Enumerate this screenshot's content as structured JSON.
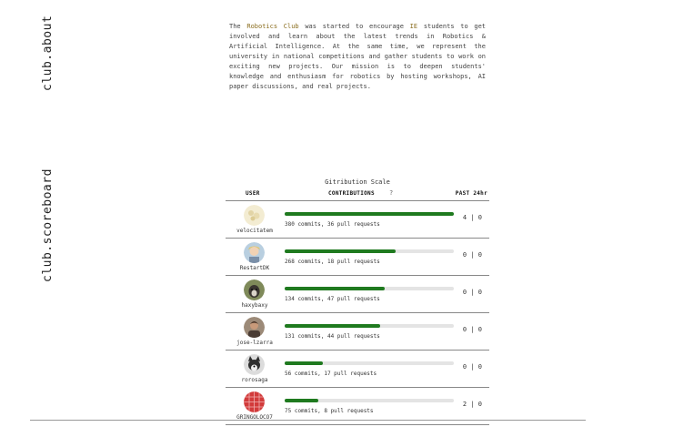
{
  "side_labels": {
    "about": "club.about",
    "scoreboard": "club.scoreboard"
  },
  "about": {
    "text_before": "The ",
    "club_name": "Robotics Club",
    "text_middle": " was started to encourage ",
    "ie": "IE",
    "text_after": " students to get involved and learn about the latest trends in Robotics & Artificial Intelligence. At the same time, we represent the university in national competitions and gather students to work on exciting new projects. Our mission is to deepen students' knowledge and enthusiasm for robotics by hosting workshops, AI paper discussions, and real projects."
  },
  "scoreboard": {
    "title": "Gitribution Scale",
    "headers": {
      "user": "USER",
      "contributions": "CONTRIBUTIONS",
      "help": "?",
      "past": "PAST 24hr"
    },
    "rows": [
      {
        "user": "velocitatem",
        "stats": "380 commits, 36 pull requests",
        "past": "4 | 0",
        "progress": 1.0,
        "avatar": "light-pattern-avatar"
      },
      {
        "user": "RestartDK",
        "stats": "268 commits, 18 pull requests",
        "past": "0 | 0",
        "progress": 0.655,
        "avatar": "cartoon-blonde-avatar"
      },
      {
        "user": "haxybaxy",
        "stats": "134 commits, 47 pull requests",
        "past": "0 | 0",
        "progress": 0.59,
        "avatar": "dog-photo-avatar"
      },
      {
        "user": "jose-lzarra",
        "stats": "131 commits, 44 pull requests",
        "past": "0 | 0",
        "progress": 0.565,
        "avatar": "person-photo-avatar"
      },
      {
        "user": "rorosaga",
        "stats": "56 commits, 17 pull requests",
        "past": "0 | 0",
        "progress": 0.225,
        "avatar": "husky-photo-avatar"
      },
      {
        "user": "GRINGOLOCO7",
        "stats": "75 commits, 8 pull requests",
        "past": "2 | 0",
        "progress": 0.2,
        "avatar": "red-pattern-avatar"
      }
    ]
  },
  "colors": {
    "bar_fill": "#1f7a1f",
    "bar_track": "#e4e4e4",
    "highlight": "#8a6d1e"
  }
}
